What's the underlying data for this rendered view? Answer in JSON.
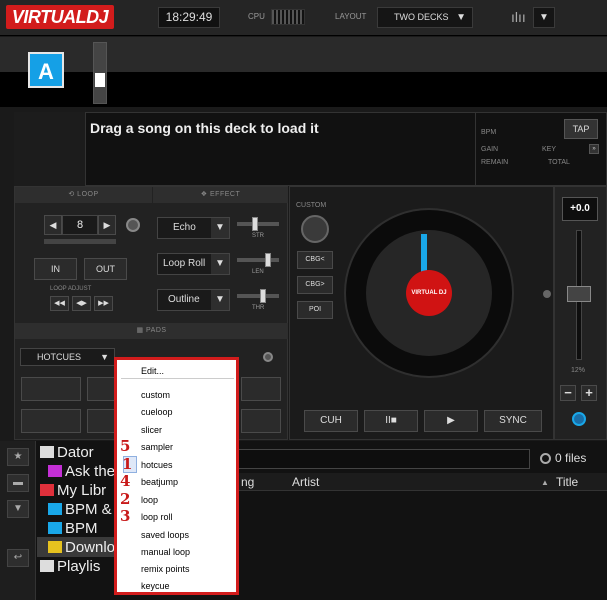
{
  "app": {
    "logo_text": "VIRTUALDJ"
  },
  "topbar": {
    "time": "18:29:49",
    "cpu_label": "CPU",
    "layout_label": "LAYOUT",
    "layout_value": "TWO DECKS"
  },
  "deck": {
    "letter": "A",
    "load_message": "Drag a song on this deck to load it",
    "bpm_label": "BPM",
    "gain_label": "GAIN",
    "key_label": "KEY",
    "remain_label": "REMAIN",
    "total_label": "TOTAL",
    "tap_label": "TAP"
  },
  "loop": {
    "header": "LOOP",
    "value": "8",
    "in_label": "IN",
    "out_label": "OUT",
    "adjust_label": "LOOP ADJUST"
  },
  "effect": {
    "header": "EFFECT",
    "slots": [
      {
        "name": "Echo",
        "slider": "STR"
      },
      {
        "name": "Loop Roll",
        "slider": "LEN"
      },
      {
        "name": "Outline",
        "slider": "THR"
      }
    ]
  },
  "pads": {
    "header": "PADS",
    "mode": "HOTCUES"
  },
  "custom": {
    "label": "CUSTOM",
    "buttons": [
      "CBG<",
      "CBG>",
      "POI"
    ]
  },
  "transport": {
    "cue": "CUH",
    "play_pause": "II■",
    "play": "▶",
    "sync": "SYNC"
  },
  "pitch": {
    "value": "+0.0",
    "range": "12%"
  },
  "platter_label": "VIRTUAL DJ",
  "browser": {
    "files_count": "0 files",
    "columns": [
      "ng",
      "Artist",
      "Title"
    ],
    "folders": [
      {
        "label": "Dator",
        "icon_color": "#dddddd"
      },
      {
        "label": "Ask the",
        "icon_color": "#c42fd6"
      },
      {
        "label": "My Libr",
        "icon_color": "#e0303b"
      },
      {
        "label": "BPM &",
        "icon_color": "#19a7e8"
      },
      {
        "label": "BPM",
        "icon_color": "#19a7e8"
      },
      {
        "label": "Downlo",
        "icon_color": "#e6c21f"
      },
      {
        "label": "Playlis",
        "icon_color": "#dddddd"
      }
    ]
  },
  "context_menu": {
    "edit_label": "Edit...",
    "items": [
      "custom",
      "cueloop",
      "slicer",
      "sampler",
      "hotcues",
      "beatjump",
      "loop",
      "loop roll",
      "saved loops",
      "manual loop",
      "remix points",
      "keycue"
    ],
    "annotations": [
      "5",
      "1",
      "4",
      "2",
      "3"
    ]
  },
  "colors": {
    "brand_red": "#d21c1c",
    "accent_blue": "#19a7e8"
  }
}
